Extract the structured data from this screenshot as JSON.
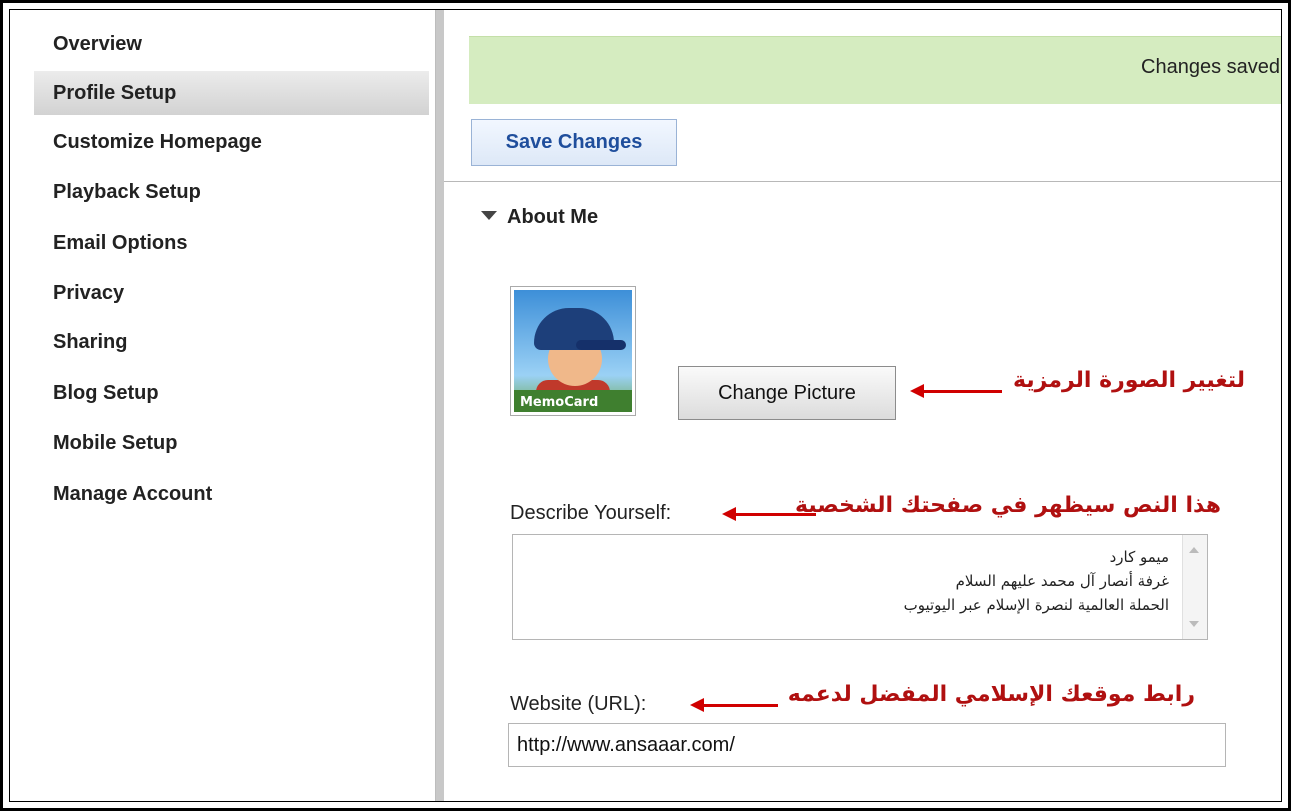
{
  "sidebar": {
    "items": [
      {
        "label": "Overview"
      },
      {
        "label": "Profile Setup"
      },
      {
        "label": "Customize Homepage"
      },
      {
        "label": "Playback Setup"
      },
      {
        "label": "Email Options"
      },
      {
        "label": "Privacy"
      },
      {
        "label": "Sharing"
      },
      {
        "label": "Blog Setup"
      },
      {
        "label": "Mobile Setup"
      },
      {
        "label": "Manage Account"
      }
    ],
    "active": "Profile Setup"
  },
  "notice": {
    "text": "Changes saved"
  },
  "toolbar": {
    "save_label": "Save Changes"
  },
  "about": {
    "section_title": "About Me",
    "avatar_logo": "MemoCard",
    "change_picture_label": "Change Picture",
    "change_picture_note": "لتغيير الصورة الرمزية",
    "describe_label": "Describe Yourself:",
    "describe_note": "هذا النص سيظهر في صفحتك الشخصية",
    "describe_lines": [
      "ميمو كارد",
      "غرفة أنصار آل محمد عليهم السلام",
      "الحملة العالمية لنصرة الإسلام عبر اليوتيوب"
    ],
    "website_label": "Website (URL):",
    "website_note": "رابط موقعك الإسلامي المفضل لدعمه",
    "website_value": "http://www.ansaaar.com/"
  },
  "colors": {
    "notice_bg": "#d5ecc0",
    "save_button_text": "#1f4e9c",
    "annotation": "#b01010"
  }
}
